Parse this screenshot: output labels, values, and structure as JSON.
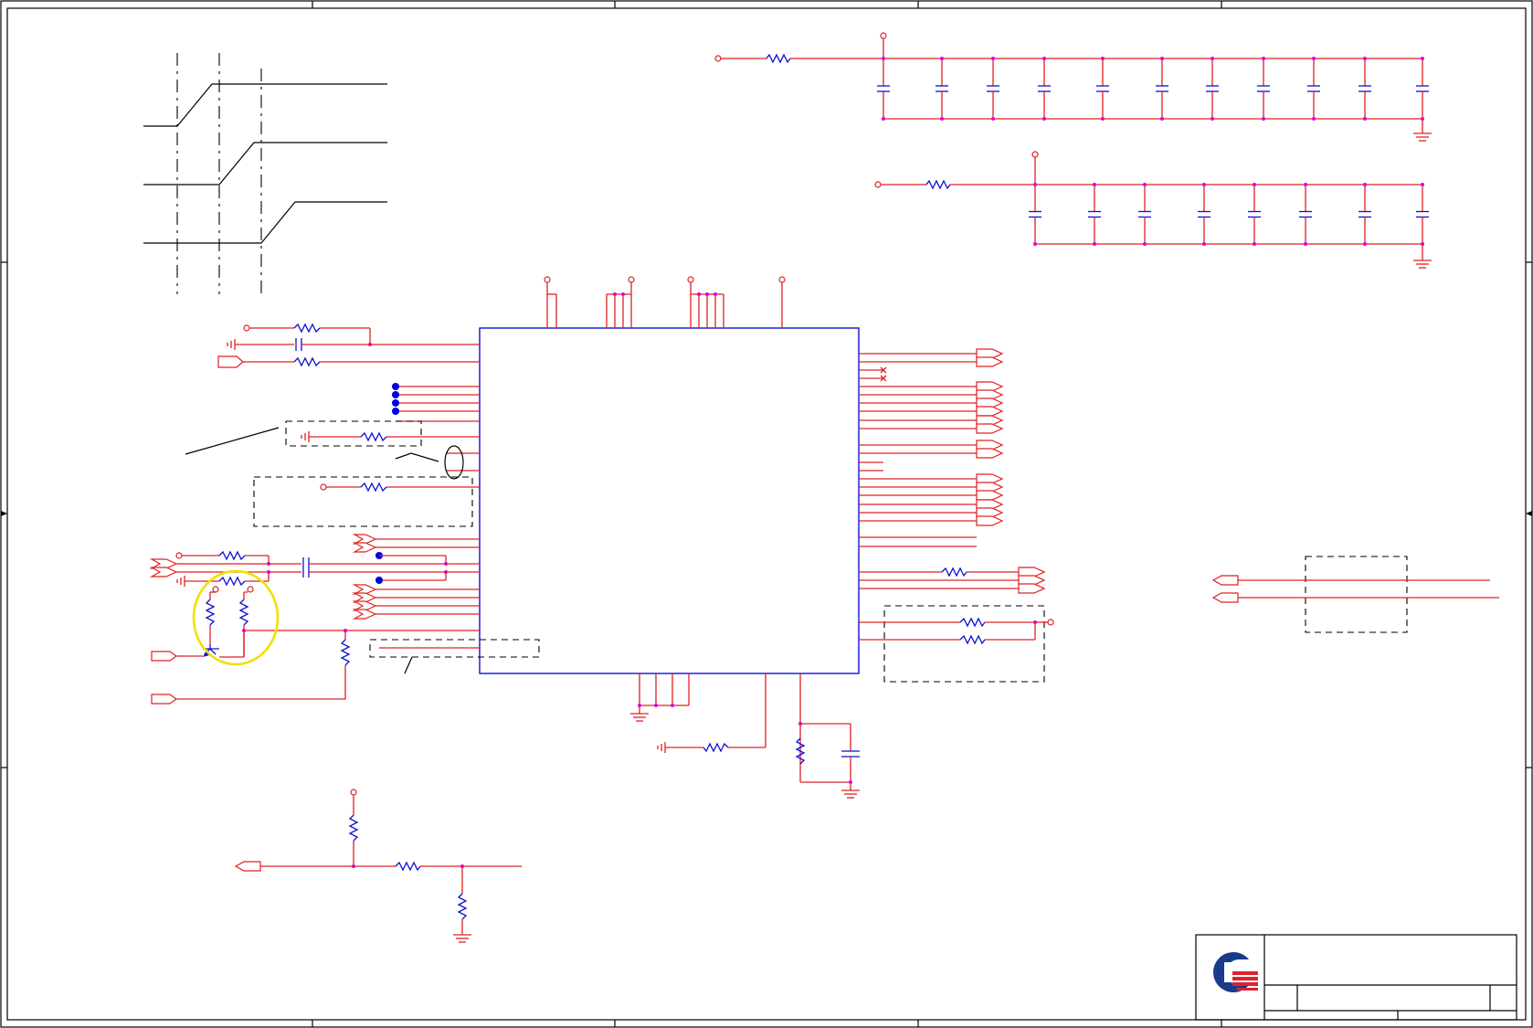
{
  "sheet": {
    "border_color": "#000000",
    "wire_color": "#e02020",
    "component_color": "#1010d0",
    "junction_color": "#e000e0",
    "highlight_color": "#f0e000"
  },
  "title_block": {
    "logo": "quanta-logo",
    "logo_colors": [
      "#1a3a8c",
      "#e02030"
    ]
  },
  "annotations": {
    "highlight_circle": "yellow-circle"
  }
}
